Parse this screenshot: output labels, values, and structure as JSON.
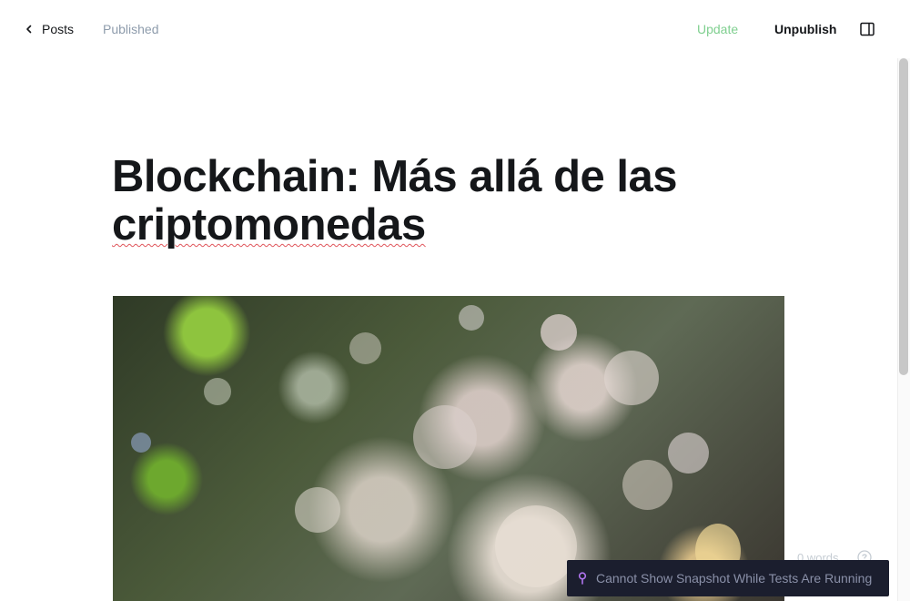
{
  "header": {
    "back_label": "Posts",
    "status": "Published",
    "update_label": "Update",
    "unpublish_label": "Unpublish"
  },
  "post": {
    "title_line1": "Blockchain: Más allá de las",
    "title_line2": "criptomonedas"
  },
  "footer": {
    "word_count": "0 words"
  },
  "toast": {
    "message": "Cannot Show Snapshot While Tests Are Running"
  },
  "colors": {
    "update_green": "#7fcf8f",
    "status_gray": "#8e9cac",
    "toast_bg": "#1b1e2e",
    "toast_pin": "#b175f0"
  },
  "icons": {
    "back": "chevron-left-icon",
    "panel": "sidebar-panel-icon",
    "help": "question-circle-icon",
    "toast": "pin-icon"
  }
}
